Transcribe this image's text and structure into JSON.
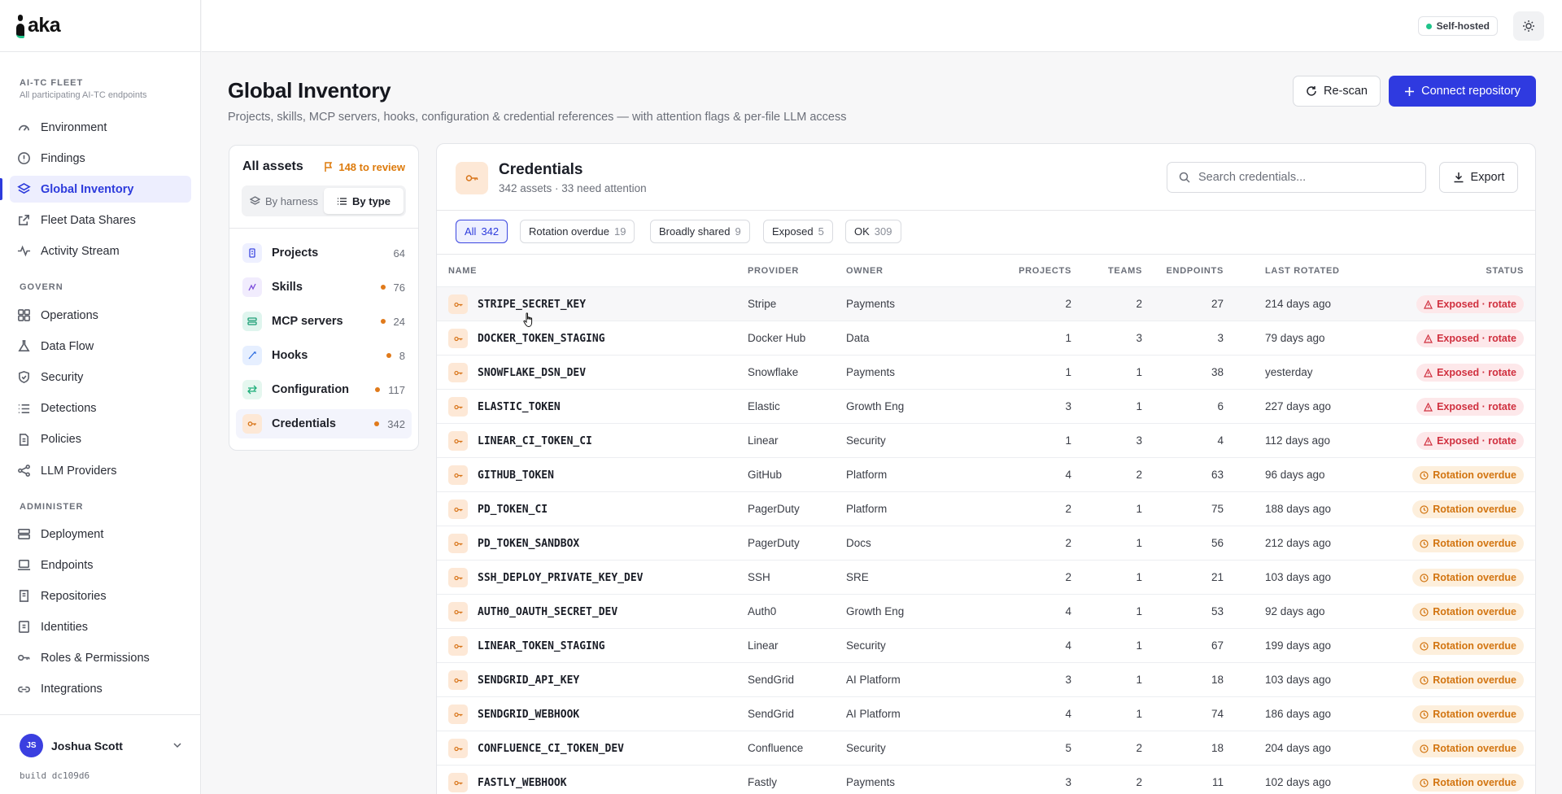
{
  "app": {
    "logo": "aka",
    "badge": "Self-hosted"
  },
  "sidebar": {
    "fleet_title": "AI-TC FLEET",
    "fleet_subtitle": "All participating AI-TC endpoints",
    "items": [
      {
        "label": "Environment",
        "icon": "gauge-icon"
      },
      {
        "label": "Findings",
        "icon": "alert-circle-icon"
      },
      {
        "label": "Global Inventory",
        "icon": "layers-icon",
        "active": true
      },
      {
        "label": "Fleet Data Shares",
        "icon": "share-icon"
      },
      {
        "label": "Activity Stream",
        "icon": "activity-icon"
      }
    ],
    "govern_title": "GOVERN",
    "govern_items": [
      {
        "label": "Operations",
        "icon": "grid-icon"
      },
      {
        "label": "Data Flow",
        "icon": "flask-icon"
      },
      {
        "label": "Security",
        "icon": "shield-icon"
      },
      {
        "label": "Detections",
        "icon": "list-icon"
      },
      {
        "label": "Policies",
        "icon": "file-icon"
      },
      {
        "label": "LLM Providers",
        "icon": "nodes-icon"
      }
    ],
    "administer_title": "ADMINISTER",
    "administer_items": [
      {
        "label": "Deployment",
        "icon": "server-icon"
      },
      {
        "label": "Endpoints",
        "icon": "laptop-icon"
      },
      {
        "label": "Repositories",
        "icon": "repo-icon"
      },
      {
        "label": "Identities",
        "icon": "id-card-icon"
      },
      {
        "label": "Roles & Permissions",
        "icon": "key-icon"
      },
      {
        "label": "Integrations",
        "icon": "link-icon"
      }
    ],
    "user": {
      "initials": "JS",
      "name": "Joshua Scott"
    },
    "build": "build dc109d6"
  },
  "page": {
    "title": "Global Inventory",
    "subtitle": "Projects, skills, MCP servers, hooks, configuration & credential references — with attention flags & per-file LLM access",
    "rescan_label": "Re-scan",
    "connect_label": "Connect repository"
  },
  "assets": {
    "title": "All assets",
    "review": "148 to review",
    "seg_harness": "By harness",
    "seg_type": "By type",
    "items": [
      {
        "label": "Projects",
        "count": "64",
        "flag": false,
        "color": "#eef0ff",
        "stroke": "#3b46e0"
      },
      {
        "label": "Skills",
        "count": "76",
        "flag": true,
        "color": "#f1ecfd",
        "stroke": "#7c4ddb"
      },
      {
        "label": "MCP servers",
        "count": "24",
        "flag": true,
        "color": "#dff5ee",
        "stroke": "#1a9e74"
      },
      {
        "label": "Hooks",
        "count": "8",
        "flag": true,
        "color": "#e6efff",
        "stroke": "#2f6ee0"
      },
      {
        "label": "Configuration",
        "count": "117",
        "flag": true,
        "color": "#e5f7ef",
        "stroke": "#1fae7a"
      },
      {
        "label": "Credentials",
        "count": "342",
        "flag": true,
        "color": "#fde8d6",
        "stroke": "#d8751a",
        "active": true
      }
    ]
  },
  "credentials": {
    "title": "Credentials",
    "subtitle": "342 assets · 33 need attention",
    "search_placeholder": "Search credentials...",
    "export_label": "Export",
    "filters": [
      {
        "label": "All",
        "count": "342",
        "active": true
      },
      {
        "label": "Rotation overdue",
        "count": "19"
      },
      {
        "label": "Broadly shared",
        "count": "9"
      },
      {
        "label": "Exposed",
        "count": "5"
      },
      {
        "label": "OK",
        "count": "309"
      }
    ],
    "columns": {
      "name": "NAME",
      "provider": "PROVIDER",
      "owner": "OWNER",
      "projects": "PROJECTS",
      "teams": "TEAMS",
      "endpoints": "ENDPOINTS",
      "last_rotated": "LAST ROTATED",
      "status": "STATUS"
    },
    "rows": [
      {
        "name": "STRIPE_SECRET_KEY",
        "provider": "Stripe",
        "owner": "Payments",
        "projects": "2",
        "teams": "2",
        "endpoints": "27",
        "rotated": "214 days ago",
        "status": "Exposed · rotate",
        "kind": "exposed"
      },
      {
        "name": "DOCKER_TOKEN_STAGING",
        "provider": "Docker Hub",
        "owner": "Data",
        "projects": "1",
        "teams": "3",
        "endpoints": "3",
        "rotated": "79 days ago",
        "status": "Exposed · rotate",
        "kind": "exposed"
      },
      {
        "name": "SNOWFLAKE_DSN_DEV",
        "provider": "Snowflake",
        "owner": "Payments",
        "projects": "1",
        "teams": "1",
        "endpoints": "38",
        "rotated": "yesterday",
        "status": "Exposed · rotate",
        "kind": "exposed"
      },
      {
        "name": "ELASTIC_TOKEN",
        "provider": "Elastic",
        "owner": "Growth Eng",
        "projects": "3",
        "teams": "1",
        "endpoints": "6",
        "rotated": "227 days ago",
        "status": "Exposed · rotate",
        "kind": "exposed"
      },
      {
        "name": "LINEAR_CI_TOKEN_CI",
        "provider": "Linear",
        "owner": "Security",
        "projects": "1",
        "teams": "3",
        "endpoints": "4",
        "rotated": "112 days ago",
        "status": "Exposed · rotate",
        "kind": "exposed"
      },
      {
        "name": "GITHUB_TOKEN",
        "provider": "GitHub",
        "owner": "Platform",
        "projects": "4",
        "teams": "2",
        "endpoints": "63",
        "rotated": "96 days ago",
        "status": "Rotation overdue",
        "kind": "overdue"
      },
      {
        "name": "PD_TOKEN_CI",
        "provider": "PagerDuty",
        "owner": "Platform",
        "projects": "2",
        "teams": "1",
        "endpoints": "75",
        "rotated": "188 days ago",
        "status": "Rotation overdue",
        "kind": "overdue"
      },
      {
        "name": "PD_TOKEN_SANDBOX",
        "provider": "PagerDuty",
        "owner": "Docs",
        "projects": "2",
        "teams": "1",
        "endpoints": "56",
        "rotated": "212 days ago",
        "status": "Rotation overdue",
        "kind": "overdue"
      },
      {
        "name": "SSH_DEPLOY_PRIVATE_KEY_DEV",
        "provider": "SSH",
        "owner": "SRE",
        "projects": "2",
        "teams": "1",
        "endpoints": "21",
        "rotated": "103 days ago",
        "status": "Rotation overdue",
        "kind": "overdue"
      },
      {
        "name": "AUTH0_OAUTH_SECRET_DEV",
        "provider": "Auth0",
        "owner": "Growth Eng",
        "projects": "4",
        "teams": "1",
        "endpoints": "53",
        "rotated": "92 days ago",
        "status": "Rotation overdue",
        "kind": "overdue"
      },
      {
        "name": "LINEAR_TOKEN_STAGING",
        "provider": "Linear",
        "owner": "Security",
        "projects": "4",
        "teams": "1",
        "endpoints": "67",
        "rotated": "199 days ago",
        "status": "Rotation overdue",
        "kind": "overdue"
      },
      {
        "name": "SENDGRID_API_KEY",
        "provider": "SendGrid",
        "owner": "AI Platform",
        "projects": "3",
        "teams": "1",
        "endpoints": "18",
        "rotated": "103 days ago",
        "status": "Rotation overdue",
        "kind": "overdue"
      },
      {
        "name": "SENDGRID_WEBHOOK",
        "provider": "SendGrid",
        "owner": "AI Platform",
        "projects": "4",
        "teams": "1",
        "endpoints": "74",
        "rotated": "186 days ago",
        "status": "Rotation overdue",
        "kind": "overdue"
      },
      {
        "name": "CONFLUENCE_CI_TOKEN_DEV",
        "provider": "Confluence",
        "owner": "Security",
        "projects": "5",
        "teams": "2",
        "endpoints": "18",
        "rotated": "204 days ago",
        "status": "Rotation overdue",
        "kind": "overdue"
      },
      {
        "name": "FASTLY_WEBHOOK",
        "provider": "Fastly",
        "owner": "Payments",
        "projects": "3",
        "teams": "2",
        "endpoints": "11",
        "rotated": "102 days ago",
        "status": "Rotation overdue",
        "kind": "overdue"
      }
    ]
  }
}
